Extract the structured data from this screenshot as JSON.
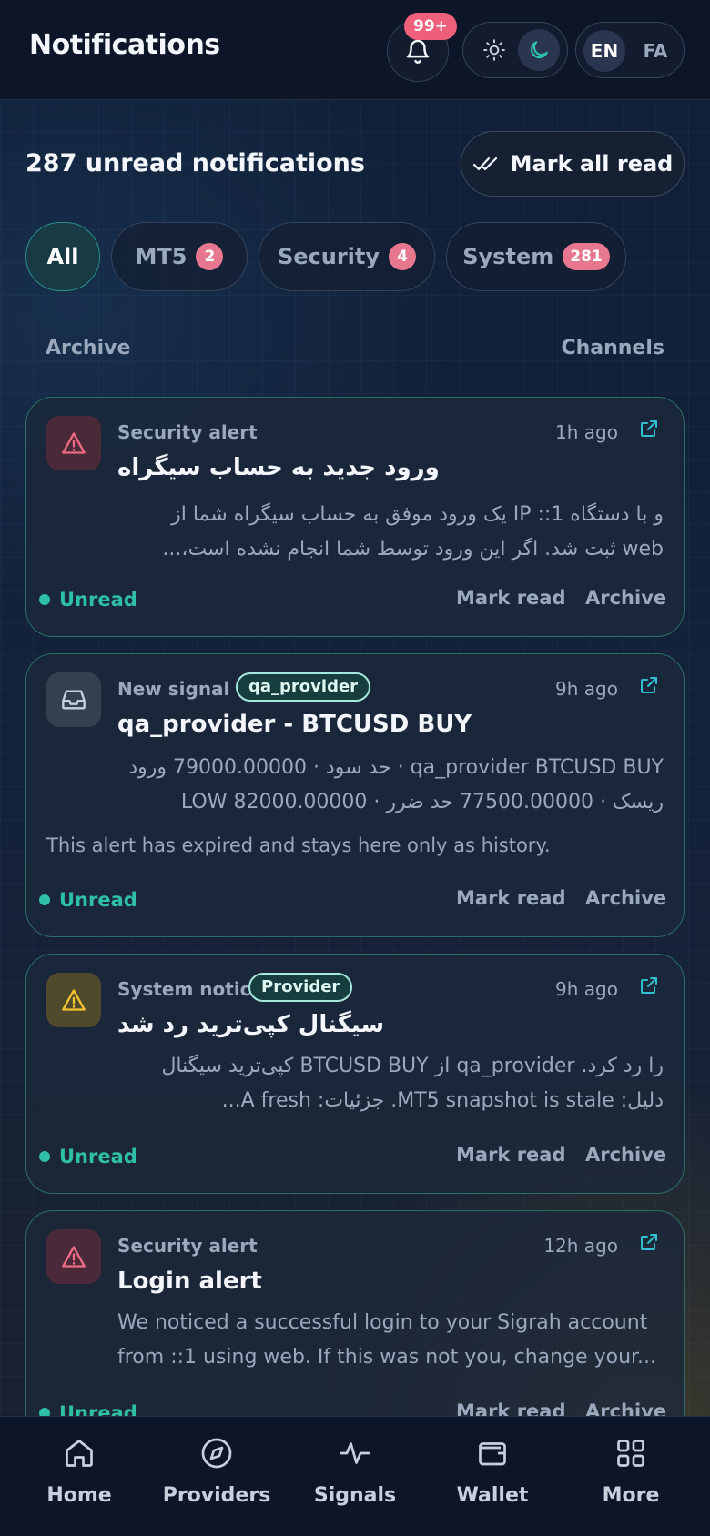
{
  "header": {
    "title": "Notifications",
    "bell_badge": "99+",
    "lang_en": "EN",
    "lang_fa": "FA"
  },
  "summary": {
    "unread_text": "287 unread notifications",
    "mark_all_label": "Mark all read"
  },
  "tabs": [
    {
      "label": "All",
      "count": null,
      "active": true
    },
    {
      "label": "MT5",
      "count": "2"
    },
    {
      "label": "Security",
      "count": "4"
    },
    {
      "label": "System",
      "count": "281"
    }
  ],
  "links": {
    "archive": "Archive",
    "channels": "Channels"
  },
  "cards": [
    {
      "category": "Security alert",
      "time": "1h ago",
      "title": "ورود جدید به حساب سیگراه",
      "body_line1": "و با دستگاه 1:: IP یک ورود موفق به حساب سیگراه شما از",
      "body_line2": "web ثبت شد. اگر این ورود توسط شما انجام نشده است،...",
      "status": "Unread",
      "mark_read": "Mark read",
      "archive": "Archive",
      "icon": "warning-icon"
    },
    {
      "category": "New signal",
      "tag": "qa_provider",
      "time": "9h ago",
      "title": "qa_provider - BTCUSD BUY",
      "body_line1": "qa_provider BTCUSD BUY · حد سود · 79000.00000 ورود",
      "body_line2": "ریسک · 77500.00000 حد ضرر · 82000.00000 LOW",
      "note": "This alert has expired and stays here only as history.",
      "status": "Unread",
      "mark_read": "Mark read",
      "archive": "Archive",
      "icon": "inbox-icon"
    },
    {
      "category": "System notice",
      "tag": "Provider",
      "time": "9h ago",
      "title": "سیگنال کپی‌ترید رد شد",
      "body_line1": "را رد کرد. qa_provider از BTCUSD BUY کپی‌ترید سیگنال",
      "body_line2": "دلیل: MT5 snapshot is stale. جزئیات: A fresh...",
      "status": "Unread",
      "mark_read": "Mark read",
      "archive": "Archive",
      "icon": "warning-icon"
    },
    {
      "category": "Security alert",
      "time": "12h ago",
      "title": "Login alert",
      "body_line1": "We noticed a successful login to your Sigrah account",
      "body_line2": "from ::1 using web. If this was not you, change your...",
      "status": "Unread",
      "mark_read": "Mark read",
      "archive": "Archive",
      "icon": "warning-icon"
    }
  ],
  "bottom_nav": [
    {
      "label": "Home",
      "icon": "home-icon"
    },
    {
      "label": "Providers",
      "icon": "compass-icon"
    },
    {
      "label": "Signals",
      "icon": "pulse-icon"
    },
    {
      "label": "Wallet",
      "icon": "wallet-icon"
    },
    {
      "label": "More",
      "icon": "grid-icon"
    }
  ],
  "colors": {
    "accent": "#2fbfa6",
    "badge": "#ee5f7a",
    "background": "#0b1424"
  }
}
